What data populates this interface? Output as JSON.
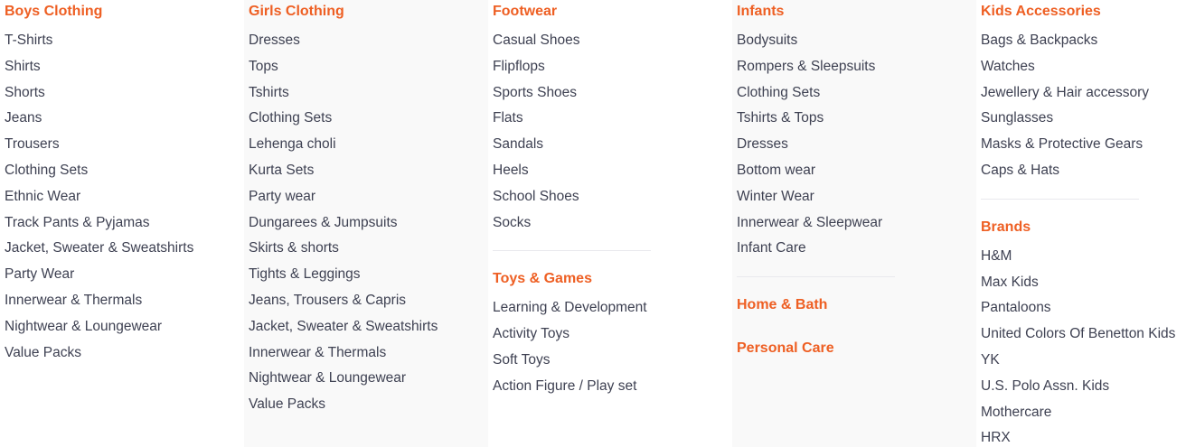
{
  "columns": [
    {
      "groups": [
        {
          "title": "Boys Clothing",
          "items": [
            "T-Shirts",
            "Shirts",
            "Shorts",
            "Jeans",
            "Trousers",
            "Clothing Sets",
            "Ethnic Wear",
            "Track Pants & Pyjamas",
            "Jacket, Sweater & Sweatshirts",
            "Party Wear",
            "Innerwear & Thermals",
            "Nightwear & Loungewear",
            "Value Packs"
          ]
        }
      ]
    },
    {
      "groups": [
        {
          "title": "Girls Clothing",
          "items": [
            "Dresses",
            "Tops",
            "Tshirts",
            "Clothing Sets",
            "Lehenga choli",
            "Kurta Sets",
            "Party wear",
            "Dungarees & Jumpsuits",
            "Skirts & shorts",
            "Tights & Leggings",
            "Jeans, Trousers & Capris",
            "Jacket, Sweater & Sweatshirts",
            "Innerwear & Thermals",
            "Nightwear & Loungewear",
            "Value Packs"
          ]
        }
      ]
    },
    {
      "groups": [
        {
          "title": "Footwear",
          "items": [
            "Casual Shoes",
            "Flipflops",
            "Sports Shoes",
            "Flats",
            "Sandals",
            "Heels",
            "School Shoes",
            "Socks"
          ]
        },
        {
          "title": "Toys & Games",
          "items": [
            "Learning & Development",
            "Activity Toys",
            "Soft Toys",
            "Action Figure / Play set"
          ]
        }
      ]
    },
    {
      "groups": [
        {
          "title": "Infants",
          "items": [
            "Bodysuits",
            "Rompers & Sleepsuits",
            "Clothing Sets",
            "Tshirts & Tops",
            "Dresses",
            "Bottom wear",
            "Winter Wear",
            "Innerwear & Sleepwear",
            "Infant Care"
          ]
        },
        {
          "title": "Home & Bath",
          "items": []
        },
        {
          "title": "Personal Care",
          "items": []
        }
      ]
    },
    {
      "groups": [
        {
          "title": "Kids Accessories",
          "items": [
            "Bags & Backpacks",
            "Watches",
            "Jewellery & Hair accessory",
            "Sunglasses",
            "Masks & Protective Gears",
            "Caps & Hats"
          ]
        },
        {
          "title": "Brands",
          "items": [
            "H&M",
            "Max Kids",
            "Pantaloons",
            "United Colors Of Benetton Kids",
            "YK",
            "U.S. Polo Assn. Kids",
            "Mothercare",
            "HRX"
          ]
        }
      ]
    }
  ]
}
